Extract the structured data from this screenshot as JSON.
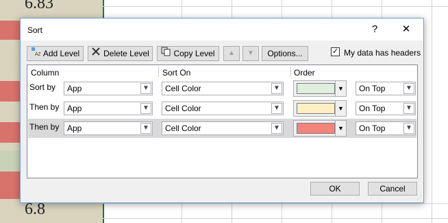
{
  "sheet": {
    "top_value": "6.83",
    "bottom_value": "6.8"
  },
  "dialog": {
    "title": "Sort",
    "help": "?",
    "close": "✕"
  },
  "toolbar": {
    "add_level": "Add Level",
    "delete_level": "Delete Level",
    "copy_level": "Copy Level",
    "move_up": "▲",
    "move_down": "▼",
    "options": "Options...",
    "headers_checkbox": "✓",
    "headers_label": "My data has headers"
  },
  "grid": {
    "headers": {
      "column": "Column",
      "sort_on": "Sort On",
      "order": "Order"
    },
    "rows": [
      {
        "label": "Sort by",
        "column": "App",
        "sort_on": "Cell Color",
        "color": "#dfeedd",
        "position": "On Top"
      },
      {
        "label": "Then by",
        "column": "App",
        "sort_on": "Cell Color",
        "color": "#fff0c4",
        "position": "On Top"
      },
      {
        "label": "Then by",
        "column": "App",
        "sort_on": "Cell Color",
        "color": "#f5847c",
        "position": "On Top"
      }
    ]
  },
  "footer": {
    "ok": "OK",
    "cancel": "Cancel"
  },
  "icons": {
    "add": "add-level-icon",
    "delete": "delete-level-icon",
    "copy": "copy-level-icon"
  }
}
